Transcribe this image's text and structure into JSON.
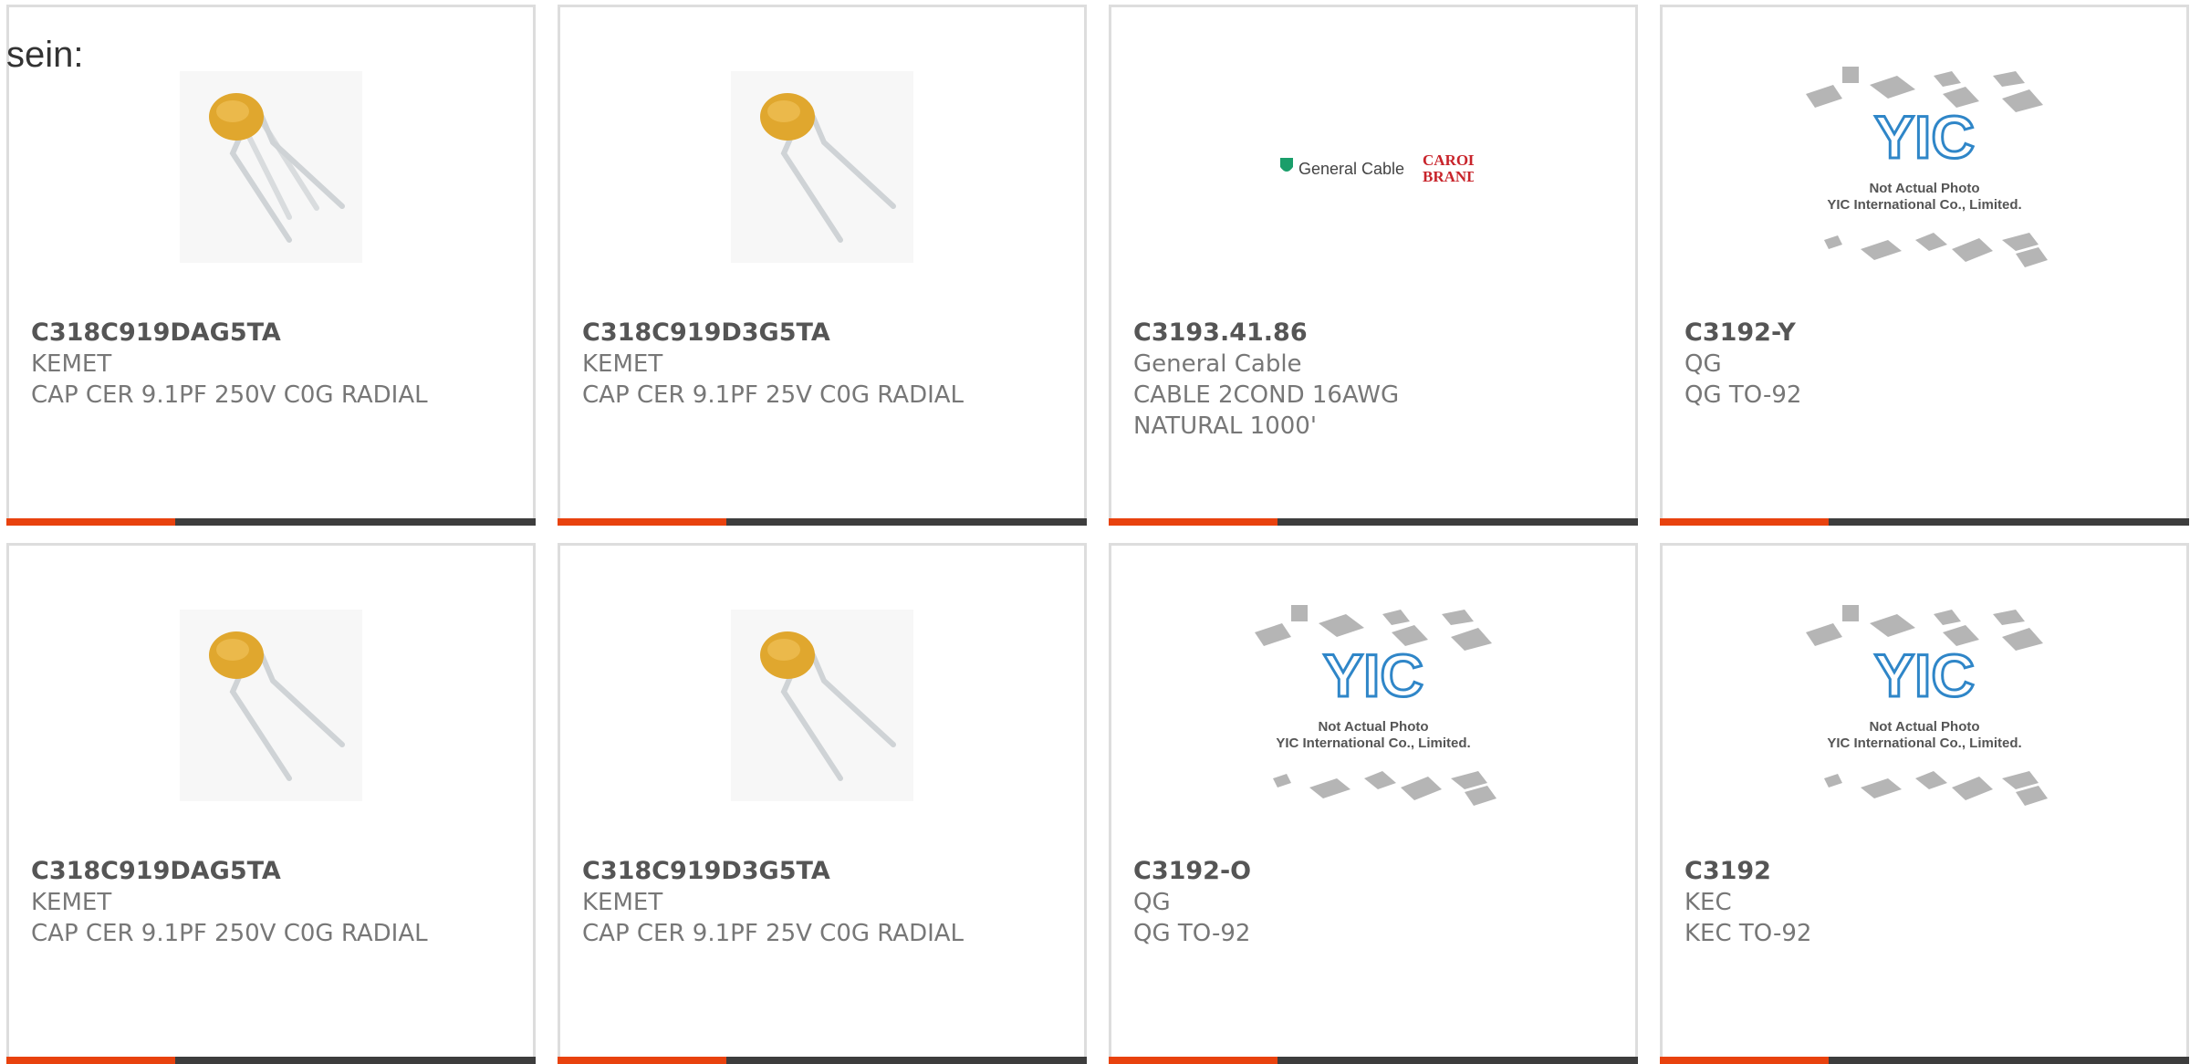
{
  "lead_text": "sein:",
  "products": [
    {
      "pn": "C318C919DAG5TA",
      "mfr": "KEMET",
      "desc": "CAP CER 9.1PF 250V C0G RADIAL",
      "image": "ceramic-capacitor"
    },
    {
      "pn": "C318C919D3G5TA",
      "mfr": "KEMET",
      "desc": "CAP CER 9.1PF 25V C0G RADIAL",
      "image": "ceramic-capacitor"
    },
    {
      "pn": "C3193.41.86",
      "mfr": "General Cable",
      "desc": "CABLE 2COND 16AWG NATURAL 1000'",
      "image": "general-cable-carol-logo",
      "logo_text": {
        "brand": "General Cable",
        "carol": "CAROL",
        "brand2": "BRAND"
      }
    },
    {
      "pn": "C3192-Y",
      "mfr": "QG",
      "desc": "QG TO-92",
      "image": "yic-placeholder",
      "placeholder_text": {
        "logo": "YIC",
        "line1": "Not Actual Photo",
        "line2": "YIC International Co., Limited."
      }
    },
    {
      "pn": "C318C919DAG5TA",
      "mfr": "KEMET",
      "desc": "CAP CER 9.1PF 250V C0G RADIAL",
      "image": "ceramic-capacitor"
    },
    {
      "pn": "C318C919D3G5TA",
      "mfr": "KEMET",
      "desc": "CAP CER 9.1PF 25V C0G RADIAL",
      "image": "ceramic-capacitor"
    },
    {
      "pn": "C3192-O",
      "mfr": "QG",
      "desc": "QG TO-92",
      "image": "yic-placeholder",
      "placeholder_text": {
        "logo": "YIC",
        "line1": "Not Actual Photo",
        "line2": "YIC International Co., Limited."
      }
    },
    {
      "pn": "C3192",
      "mfr": "KEC",
      "desc": "KEC TO-92",
      "image": "yic-placeholder",
      "placeholder_text": {
        "logo": "YIC",
        "line1": "Not Actual Photo",
        "line2": "YIC International Co., Limited."
      }
    }
  ],
  "colors": {
    "accent": "#e8420e",
    "bar": "#3d3d3d",
    "border": "#dddddd",
    "capacitor": "#e0a72e"
  }
}
